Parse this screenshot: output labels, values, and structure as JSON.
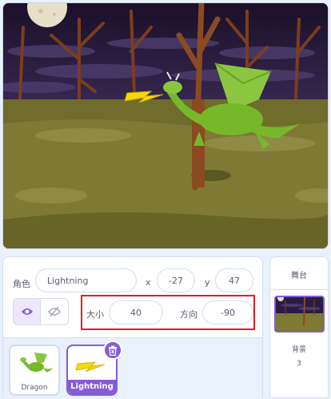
{
  "sprite_info": {
    "sprite_label": "角色",
    "sprite_name": "Lightning",
    "x_label": "x",
    "x_value": "-27",
    "y_label": "y",
    "y_value": "47",
    "size_label": "大小",
    "size_value": "40",
    "direction_label": "方向",
    "direction_value": "-90"
  },
  "sprites": [
    {
      "name": "Dragon"
    },
    {
      "name": "Lightning"
    }
  ],
  "stage_panel": {
    "title": "舞台",
    "backdrops_label": "背景",
    "backdrops_count": "3"
  },
  "colors": {
    "accent": "#855cd6",
    "highlight": "#e21f1f",
    "sky": "#1d1330",
    "ground": "#6b6a2a"
  },
  "icons": {
    "show": "eye-icon",
    "hide": "eye-slash-icon",
    "delete": "trash-icon"
  }
}
